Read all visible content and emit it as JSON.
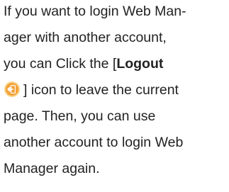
{
  "paragraph": {
    "line1": "If you want to login Web Man-",
    "line2": "ager with another account,",
    "line3_pre": "you can Click the [",
    "line3_bold": "Logout",
    "line4_post": "] icon to leave the current",
    "line5": "page. Then, you can use",
    "line6": "another account to login Web",
    "line7": "Manager again."
  },
  "icons": {
    "logout": "logout-icon"
  },
  "colors": {
    "text": "#222222",
    "icon_fill": "#f2a33a",
    "icon_ring": "#fbd38a"
  }
}
